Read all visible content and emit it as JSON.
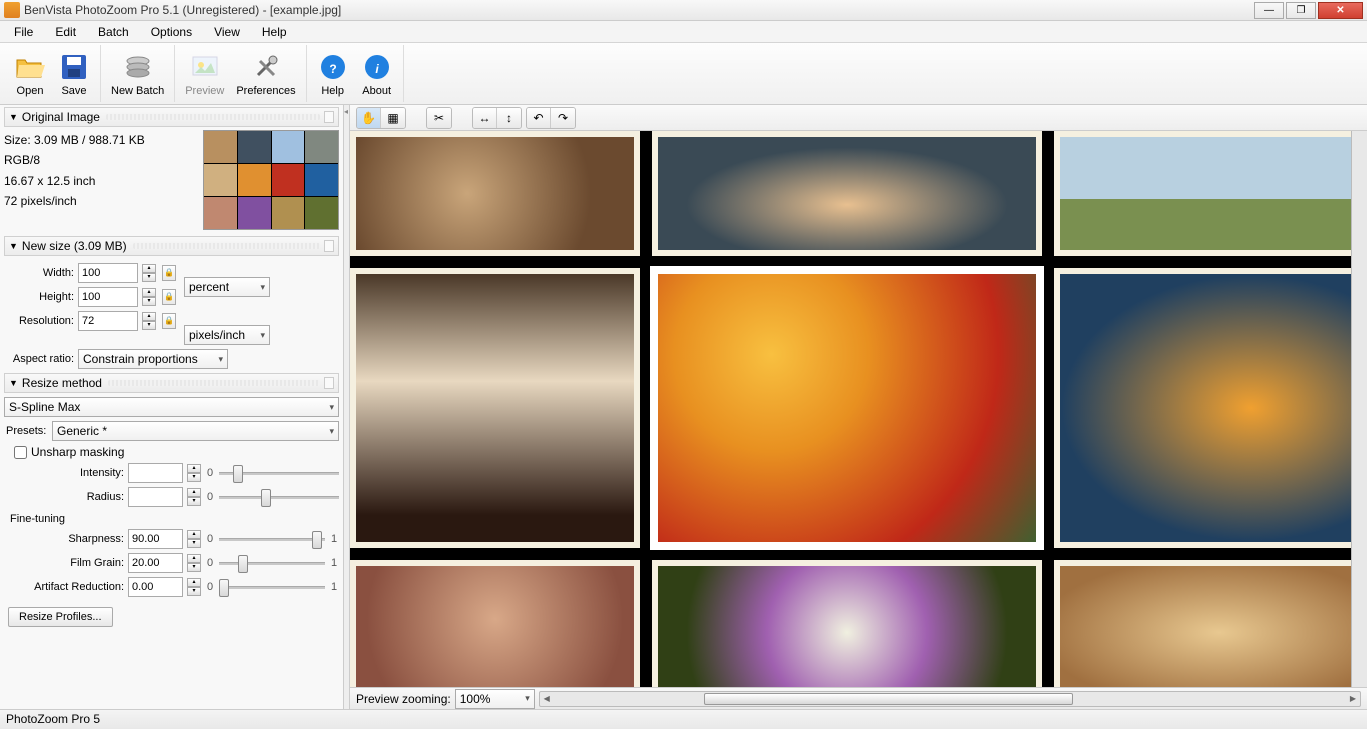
{
  "title": "BenVista PhotoZoom Pro 5.1 (Unregistered) - [example.jpg]",
  "menu": [
    "File",
    "Edit",
    "Batch",
    "Options",
    "View",
    "Help"
  ],
  "toolbar": [
    {
      "label": "Open",
      "icon": "folder"
    },
    {
      "label": "Save",
      "icon": "disk"
    },
    {
      "label": "New Batch",
      "icon": "stack"
    },
    {
      "label": "Preview",
      "icon": "preview",
      "disabled": true
    },
    {
      "label": "Preferences",
      "icon": "tools"
    },
    {
      "label": "Help",
      "icon": "help"
    },
    {
      "label": "About",
      "icon": "about"
    }
  ],
  "orig": {
    "header": "Original Image",
    "size": "Size: 3.09 MB / 988.71 KB",
    "mode": "RGB/8",
    "dims": "16.67 x 12.5 inch",
    "res": "72 pixels/inch"
  },
  "newsize": {
    "header": "New size (3.09 MB)",
    "width_lbl": "Width:",
    "width": "100",
    "height_lbl": "Height:",
    "height": "100",
    "unit": "percent",
    "res_lbl": "Resolution:",
    "res": "72",
    "res_unit": "pixels/inch",
    "aspect_lbl": "Aspect ratio:",
    "aspect": "Constrain proportions"
  },
  "resize": {
    "header": "Resize method",
    "method": "S-Spline Max",
    "presets_lbl": "Presets:",
    "preset": "Generic *",
    "unsharp": "Unsharp masking",
    "intensity_lbl": "Intensity:",
    "intensity": "",
    "radius_lbl": "Radius:",
    "radius": "",
    "fine": "Fine-tuning",
    "sharp_lbl": "Sharpness:",
    "sharp": "90.00",
    "grain_lbl": "Film Grain:",
    "grain": "20.00",
    "artifact_lbl": "Artifact Reduction:",
    "artifact": "0.00",
    "range0": "0",
    "range1": "1",
    "profiles_btn": "Resize Profiles..."
  },
  "preview": {
    "zoom_lbl": "Preview zooming:",
    "zoom": "100%"
  },
  "status": "PhotoZoom Pro 5"
}
